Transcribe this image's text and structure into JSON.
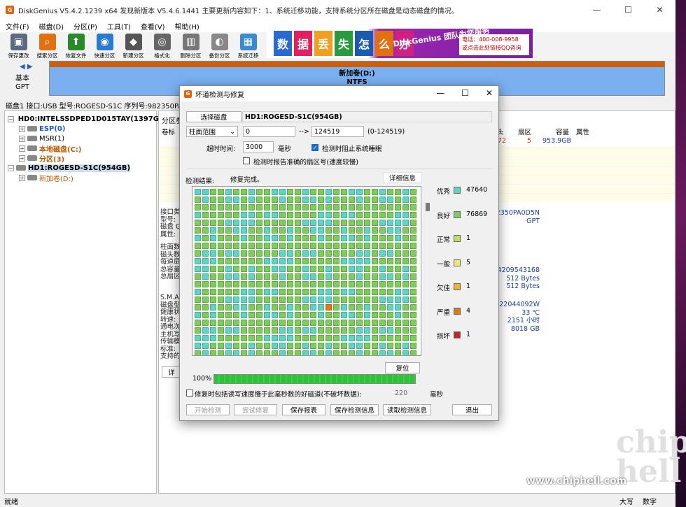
{
  "app": {
    "title": "DiskGenius V5.4.2.1239 x64    发现新版本 V5.4.6.1441    主要更新内容如下：1、系统迁移功能，支持系统分区所在磁盘是动态磁盘的情况。",
    "icon_letter": "G"
  },
  "menu": [
    "文件(F)",
    "磁盘(D)",
    "分区(P)",
    "工具(T)",
    "查看(V)",
    "帮助(H)"
  ],
  "toolbar": [
    {
      "label": "保存更改",
      "icon": "save-icon",
      "color": "#5a6a80"
    },
    {
      "label": "搜索分区",
      "icon": "search-icon",
      "color": "#e07010"
    },
    {
      "label": "恢复文件",
      "icon": "restore-icon",
      "color": "#2a8a2a"
    },
    {
      "label": "快速分区",
      "icon": "quick-partition-icon",
      "color": "#2a7ad0"
    },
    {
      "label": "新建分区",
      "icon": "new-partition-icon",
      "color": "#555"
    },
    {
      "label": "格式化",
      "icon": "format-icon",
      "color": "#666"
    },
    {
      "label": "删除分区",
      "icon": "delete-icon",
      "color": "#777"
    },
    {
      "label": "备份分区",
      "icon": "backup-icon",
      "color": "#888"
    },
    {
      "label": "系统迁移",
      "icon": "migrate-icon",
      "color": "#3a8ad0"
    }
  ],
  "banner": {
    "chars": [
      "数",
      "据",
      "丢",
      "失",
      "怎",
      "么",
      "办"
    ],
    "promo": "DiskGenius 团队为您服务",
    "phone": "电话：400-008-9958",
    "qq": "或点击此处链接QQ咨询"
  },
  "diskbar": {
    "disk_type_1": "基本",
    "disk_type_2": "GPT",
    "partition_name": "新加卷(D:)",
    "partition_fs": "NTFS",
    "info_line": "磁盘1 接口:USB  型号:ROGESD-S1C  序列号:982350PA0D"
  },
  "tree": [
    {
      "label": "HD0:INTELSSDPED1D015TAY(1397GB)",
      "level": 0,
      "color": "#000",
      "bold": true
    },
    {
      "label": "ESP(0)",
      "level": 1,
      "color": "#1a5ad0",
      "bold": true
    },
    {
      "label": "MSR(1)",
      "level": 1,
      "color": "#000",
      "bold": false
    },
    {
      "label": "本地磁盘(C:)",
      "level": 1,
      "color": "#b85a00",
      "bold": true
    },
    {
      "label": "分区(3)",
      "level": 1,
      "color": "#b85a00",
      "bold": true
    },
    {
      "label": "HD1:ROGESD-S1C(954GB)",
      "level": 0,
      "color": "#000",
      "bold": true,
      "selected": true
    },
    {
      "label": "新加卷(D:)",
      "level": 1,
      "color": "#b85a00",
      "bold": false
    }
  ],
  "right_pane": {
    "tab": "分区参",
    "col_label": "卷标",
    "headers": [
      "头",
      "扇区",
      "容量",
      "属性"
    ],
    "row": [
      "172",
      "5",
      "953.9GB"
    ],
    "info_labels_1": [
      "接口类",
      "型号:",
      "磁盘 G",
      "属性:"
    ],
    "info_labels_2": [
      "柱面数",
      "磁头数",
      "每道扇",
      "总容量",
      "总扇区"
    ],
    "info_labels_3": [
      "S.M.A.",
      "磁盘型",
      "健康状",
      "转速:",
      "通电次",
      "主机写",
      "传输模",
      "标准:",
      "支持的"
    ],
    "info_vals_1": [
      "2350PA0D5N",
      "GPT"
    ],
    "info_vals_2": [
      "4209543168",
      "512 Bytes",
      "512 Bytes"
    ],
    "info_vals_3": [
      "A22044092W",
      "33 ℃",
      "2151 小时",
      "8018 GB"
    ],
    "bottom_btn": "详"
  },
  "dialog": {
    "title": "坏道检测与修复",
    "select_disk_btn": "选择磁盘",
    "disk_name": "HD1:ROGESD-S1C(954GB)",
    "range_type": "柱面范围",
    "range_start": "0",
    "range_arrow": "-->",
    "range_end": "124519",
    "range_hint": "(0-124519)",
    "timeout_label": "超时时间:",
    "timeout_value": "3000",
    "timeout_unit": "毫秒",
    "stop_sleep_label": "检测时阻止系统睡眠",
    "stop_sleep_checked": true,
    "report_sector_label": "检测时报告准确的扇区号(速度较慢)",
    "report_sector_checked": false,
    "result_label": "检测结果:",
    "result_status": "修复完成。",
    "detail_btn": "详细信息",
    "reset_btn": "复位",
    "progress_text": "100%",
    "progress_value": 1.0,
    "repair_opt_label": "修复时包括读写速度慢于此毫秒数的好磁道(不破坏数据):",
    "repair_opt_value": "220",
    "repair_opt_unit": "毫秒",
    "buttons": {
      "start": "开始检测",
      "try_repair": "尝试修复",
      "save_report": "保存报表",
      "save_info": "保存检测信息",
      "read_info": "读取检测信息",
      "exit": "退出"
    },
    "legend": [
      {
        "label": "优秀",
        "count": "47640",
        "color": "#5cd6c0"
      },
      {
        "label": "良好",
        "count": "76869",
        "color": "#7ccd5a"
      },
      {
        "label": "正常",
        "count": "1",
        "color": "#bfe05a"
      },
      {
        "label": "一般",
        "count": "5",
        "color": "#f2e27a"
      },
      {
        "label": "欠佳",
        "count": "1",
        "color": "#f0b22a"
      },
      {
        "label": "严重",
        "count": "4",
        "color": "#e07a10"
      },
      {
        "label": "损坏",
        "count": "1",
        "color": "#c8202a"
      }
    ],
    "grid": {
      "cols": 29,
      "rows": 22,
      "base_color": "#7ccd5a",
      "alt_color": "#5cd6c0",
      "marked_cell_color": "#e07a10"
    }
  },
  "statusbar": {
    "left": "就绪",
    "caps": "大写",
    "num": "数字"
  },
  "watermark": {
    "url": "www.chiphell.com",
    "logo": "chip hell"
  }
}
